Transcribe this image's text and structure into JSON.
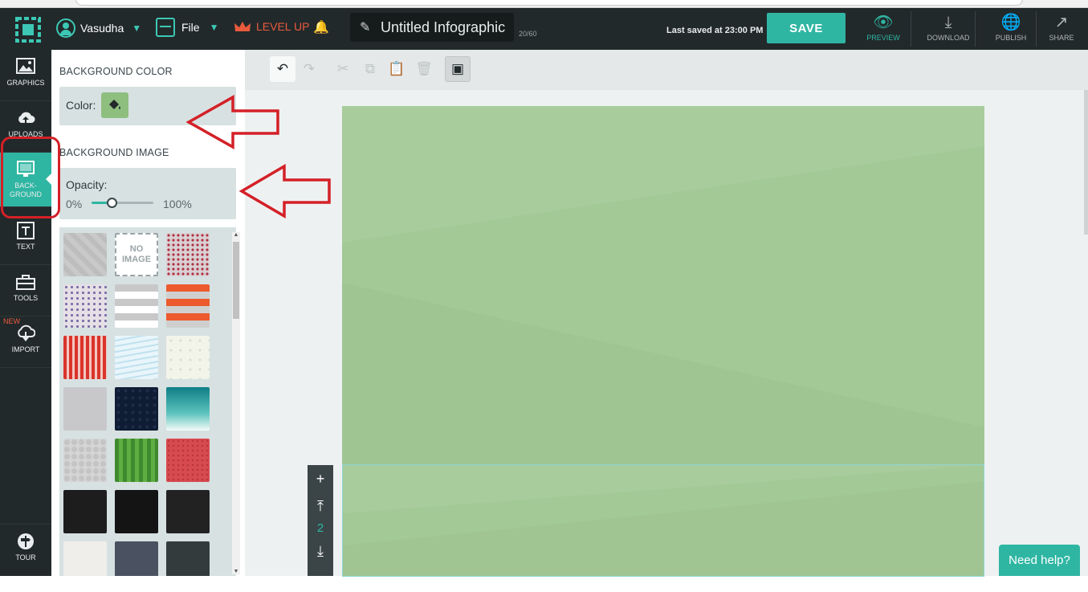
{
  "topbar": {
    "user_name": "Vasudha",
    "file_label": "File",
    "level_up_label": "LEVEL UP",
    "document_title": "Untitled Infographic",
    "title_char_count": "20/60",
    "last_saved": "Last saved at 23:00 PM",
    "save_label": "SAVE",
    "preview_label": "PREVIEW",
    "download_label": "DOWNLOAD",
    "publish_label": "PUBLISH",
    "share_label": "SHARE"
  },
  "sidebar": {
    "items": [
      {
        "label": "GRAPHICS",
        "icon": "image-icon"
      },
      {
        "label": "UPLOADS",
        "icon": "cloud-upload-icon"
      },
      {
        "label": "BACK-\nGROUND",
        "icon": "background-icon",
        "active": true
      },
      {
        "label": "TEXT",
        "icon": "text-icon"
      },
      {
        "label": "TOOLS",
        "icon": "toolbox-icon"
      },
      {
        "label": "IMPORT",
        "icon": "cloud-download-icon",
        "badge": "NEW"
      }
    ],
    "tour_label": "TOUR"
  },
  "panel": {
    "background_color_title": "BACKGROUND COLOR",
    "color_label": "Color:",
    "current_color": "#8fbf7f",
    "background_image_title": "BACKGROUND IMAGE",
    "opacity_label": "Opacity:",
    "opacity_min": "0%",
    "opacity_max": "100%",
    "opacity_value": 0.32,
    "no_image_label": "NO\nIMAGE",
    "tiles": [
      "gray-texture",
      "no-image",
      "red-dots",
      "blue-red-dots",
      "gray-stripes",
      "orange-stripes",
      "red-vertical-stripes",
      "blue-waves",
      "cream-stars",
      "light-gray",
      "dark-navy",
      "teal-gradient",
      "gray-pattern",
      "green-stripes",
      "red-texture",
      "black-1",
      "black-2",
      "black-3",
      "off-white",
      "slate-blue",
      "dark-slate"
    ]
  },
  "canvas": {
    "background_color": "#a3c996",
    "page_number": "2"
  },
  "help_label": "Need help?",
  "colors": {
    "accent": "#2fb6a3",
    "topbar": "#22292b",
    "level_up": "#ea5a3c",
    "annotation": "#d42027"
  }
}
